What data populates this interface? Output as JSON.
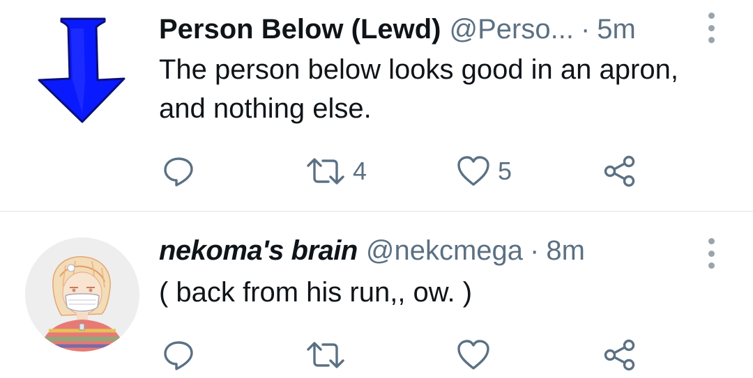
{
  "tweets": [
    {
      "display_name": "Person Below (Lewd)",
      "handle": "@Perso...",
      "separator": "·",
      "time": "5m",
      "text": "The person below looks good in an apron, and nothing else.",
      "avatar_icon": "blue-down-arrow",
      "replies": "",
      "retweets": "4",
      "likes": "5"
    },
    {
      "display_name": "nekoma's brain",
      "handle": "@nekcmega",
      "separator": "·",
      "time": "8m",
      "text": "( back from his run,, ow. )",
      "avatar_icon": "illustrated-character-with-face-mask",
      "replies": "",
      "retweets": "",
      "likes": ""
    }
  ],
  "colors": {
    "text_primary": "#0f1419",
    "text_secondary": "#5b7083",
    "divider": "#dfe3e6",
    "arrow_fill": "#0a1aff",
    "arrow_outline": "#0b0f7a",
    "more_dots": "#9aa4ad"
  }
}
